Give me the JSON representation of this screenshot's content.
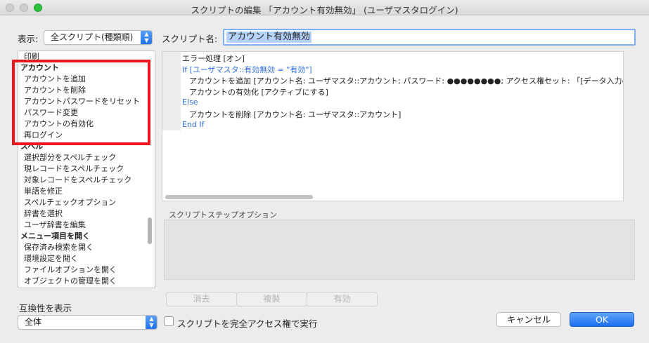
{
  "window": {
    "title": "スクリプトの編集 「アカウント有効無効」 (ユーザマスタログイン)"
  },
  "left": {
    "show_label": "表示:",
    "show_value": "全スクリプト(種類順)",
    "list": [
      {
        "text": "印刷",
        "category": false
      },
      {
        "text": "アカウント",
        "category": true
      },
      {
        "text": "アカウントを追加",
        "category": false
      },
      {
        "text": "アカウントを削除",
        "category": false
      },
      {
        "text": "アカウントパスワードをリセット",
        "category": false
      },
      {
        "text": "パスワード変更",
        "category": false
      },
      {
        "text": "アカウントの有効化",
        "category": false
      },
      {
        "text": "再ログイン",
        "category": false
      },
      {
        "text": "スペル",
        "category": true
      },
      {
        "text": "選択部分をスペルチェック",
        "category": false
      },
      {
        "text": "現レコードをスペルチェック",
        "category": false
      },
      {
        "text": "対象レコードをスペルチェック",
        "category": false
      },
      {
        "text": "単語を修正",
        "category": false
      },
      {
        "text": "スペルチェックオプション",
        "category": false
      },
      {
        "text": "辞書を選択",
        "category": false
      },
      {
        "text": "ユーザ辞書を編集",
        "category": false
      },
      {
        "text": "メニュー項目を開く",
        "category": true
      },
      {
        "text": "保存済み検索を開く",
        "category": false
      },
      {
        "text": "環境設定を開く",
        "category": false
      },
      {
        "text": "ファイルオプションを開く",
        "category": false
      },
      {
        "text": "オブジェクトの管理を開く",
        "category": false
      }
    ],
    "compat_label": "互換性を表示",
    "compat_value": "全体"
  },
  "script": {
    "name_label": "スクリプト名:",
    "name_value": "アカウント有効無効",
    "lines": [
      {
        "text": "エラー処理 [オン]",
        "indent": 0,
        "blue": false
      },
      {
        "text": "If [ユーザマスタ::有効無効 = \"有効\"]",
        "indent": 0,
        "blue": true
      },
      {
        "text": "アカウントを追加 [アカウント名: ユーザマスタ::アカウント; パスワード: ●●●●●●●●; アクセス権セット: 「[データ入力のみ]」",
        "indent": 1,
        "blue": false
      },
      {
        "text": "アカウントの有効化 [アクティブにする]",
        "indent": 1,
        "blue": false
      },
      {
        "text": "Else",
        "indent": 0,
        "blue": true
      },
      {
        "text": "アカウントを削除 [アカウント名: ユーザマスタ::アカウント]",
        "indent": 1,
        "blue": false
      },
      {
        "text": "End If",
        "indent": 0,
        "blue": true
      }
    ]
  },
  "options": {
    "label": "スクリプトステップオプション",
    "clear": "消去",
    "duplicate": "複製",
    "enable": "有効"
  },
  "footer": {
    "full_access_label": "スクリプトを完全アクセス権で実行",
    "cancel": "キャンセル",
    "ok": "OK"
  },
  "colors": {
    "accent": "#1c6ff1",
    "highlight_box": "#f0141e",
    "control_flow": "#2f6fe3"
  }
}
